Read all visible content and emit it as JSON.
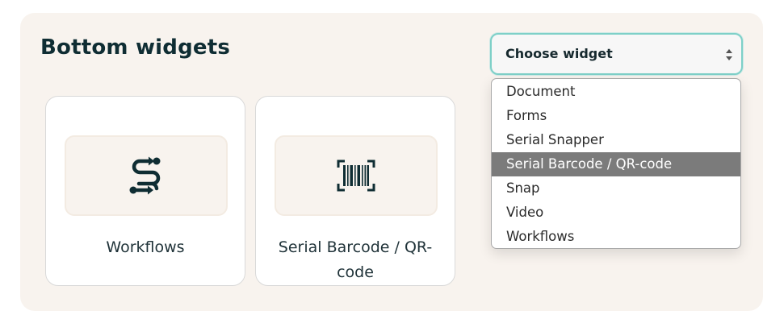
{
  "section": {
    "title": "Bottom widgets"
  },
  "cards": [
    {
      "label": "Workflows",
      "icon": "workflow-icon"
    },
    {
      "label": "Serial Barcode / QR-code",
      "icon": "barcode-icon"
    }
  ],
  "select": {
    "value": "Choose widget",
    "icon": "up-down-arrows-icon"
  },
  "dropdown": {
    "options": [
      "Document",
      "Forms",
      "Serial Snapper",
      "Serial Barcode / QR-code",
      "Snap",
      "Video",
      "Workflows"
    ],
    "highlighted": "Serial Barcode / QR-code"
  },
  "colors": {
    "panel_background": "#f8f3ee",
    "text_dark": "#0f2d33",
    "focus_border": "#7ed0c8",
    "highlight_background": "#7b7b7b"
  }
}
